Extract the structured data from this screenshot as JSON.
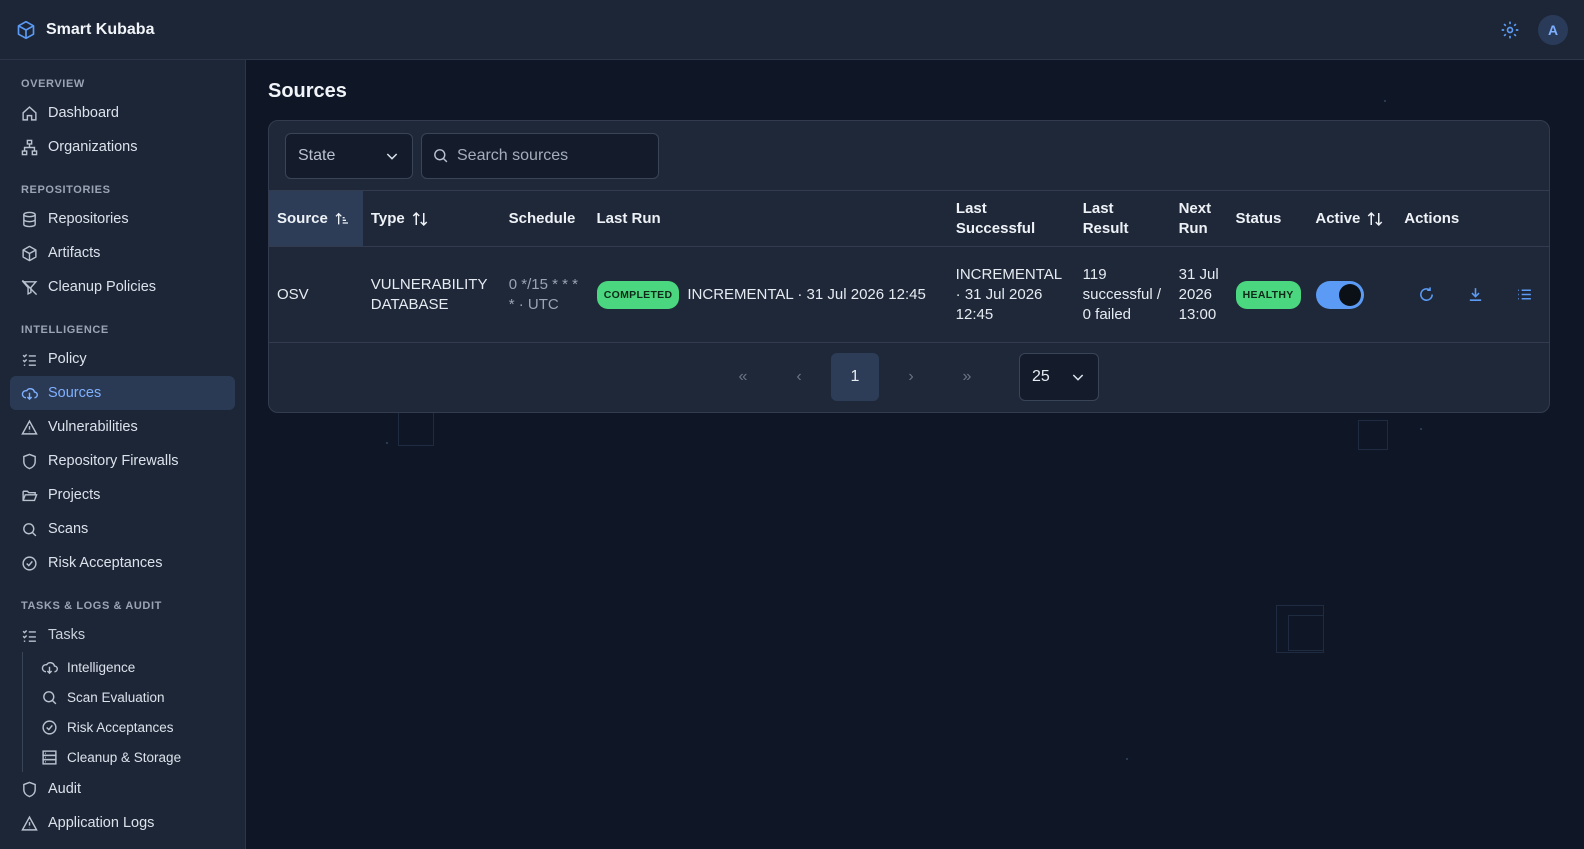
{
  "app": {
    "name": "Smart Kubaba",
    "avatar_initial": "A",
    "accent": "#5b9bf5"
  },
  "sidebar": {
    "sections": [
      {
        "title": "OVERVIEW",
        "items": [
          "Dashboard",
          "Organizations"
        ]
      },
      {
        "title": "REPOSITORIES",
        "items": [
          "Repositories",
          "Artifacts",
          "Cleanup Policies"
        ]
      },
      {
        "title": "INTELLIGENCE",
        "items": [
          "Policy",
          "Sources",
          "Vulnerabilities",
          "Repository Firewalls",
          "Projects",
          "Scans",
          "Risk Acceptances"
        ]
      },
      {
        "title": "TASKS & LOGS & AUDIT",
        "items": [
          "Tasks"
        ]
      }
    ],
    "active_item": "Sources",
    "tasks_sub": [
      "Intelligence",
      "Scan Evaluation",
      "Risk Acceptances",
      "Cleanup & Storage"
    ],
    "bottom_items": [
      "Audit",
      "Application Logs"
    ]
  },
  "page": {
    "title": "Sources"
  },
  "filters": {
    "state_label": "State",
    "search_placeholder": "Search sources"
  },
  "table": {
    "columns": [
      "Source",
      "Type",
      "Schedule",
      "Last Run",
      "Last Successful",
      "Last Result",
      "Next Run",
      "Status",
      "Active",
      "Actions"
    ],
    "rows": [
      {
        "source": "OSV",
        "type": "VULNERABILITY DATABASE",
        "schedule": "0 */15 * * * * · UTC",
        "last_run_badge": "COMPLETED",
        "last_run": "INCREMENTAL · 31 Jul 2026 12:45",
        "last_successful": "INCREMENTAL · 31 Jul 2026 12:45",
        "last_result": "119 successful / 0 failed",
        "next_run": "31 Jul 2026 13:00",
        "status": "HEALTHY",
        "active": true
      }
    ]
  },
  "pagination": {
    "current_page": "1",
    "page_size": "25",
    "first": "«",
    "prev": "‹",
    "next": "›",
    "last": "»"
  },
  "icons": {
    "brand": "cube-icon",
    "settings": "gear-icon",
    "sort": "sort-icon",
    "actions": [
      "refresh-icon",
      "download-icon",
      "list-icon"
    ]
  }
}
